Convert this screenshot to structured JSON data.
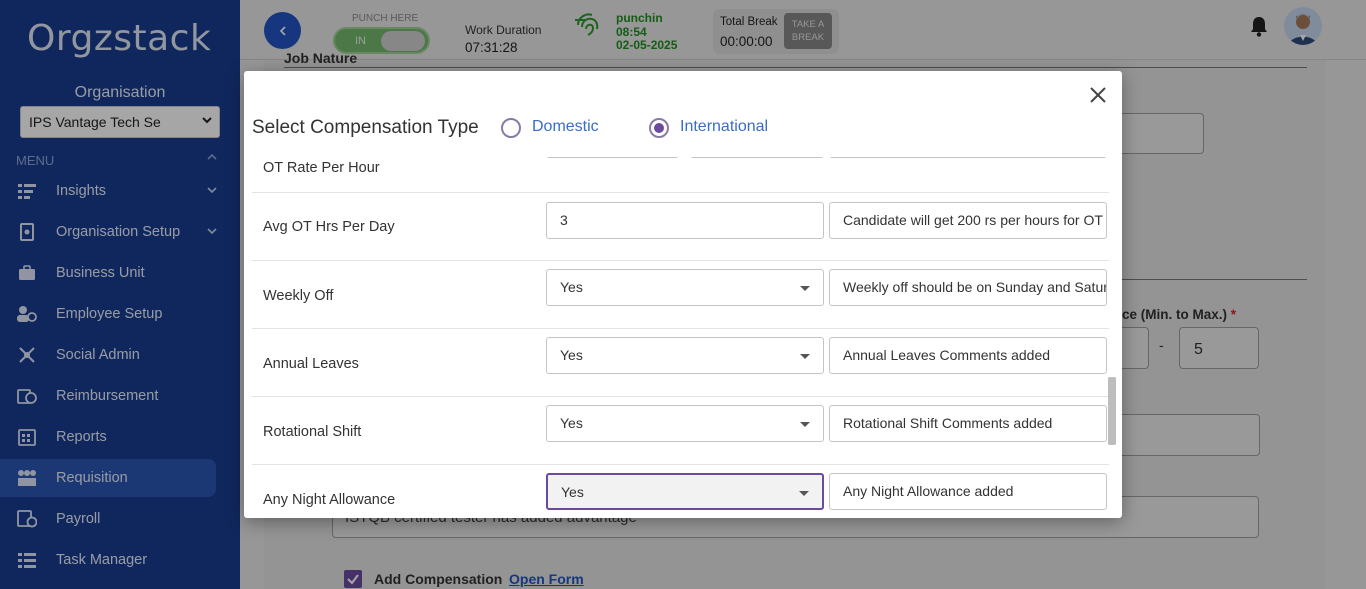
{
  "sidebar": {
    "logo": "Orgzstack",
    "org_label": "Organisation",
    "org_select_value": "IPS Vantage Tech Se",
    "menu_label": "MENU",
    "items": [
      {
        "label": "Insights",
        "icon": "insights-icon"
      },
      {
        "label": "Organisation Setup",
        "icon": "organisation-setup-icon"
      },
      {
        "label": "Business Unit",
        "icon": "briefcase-icon"
      },
      {
        "label": "Employee Setup",
        "icon": "employee-icon"
      },
      {
        "label": "Social Admin",
        "icon": "social-icon"
      },
      {
        "label": "Reimbursement",
        "icon": "reimbursement-icon"
      },
      {
        "label": "Reports",
        "icon": "reports-icon"
      },
      {
        "label": "Requisition",
        "icon": "requisition-icon"
      },
      {
        "label": "Payroll",
        "icon": "payroll-icon"
      },
      {
        "label": "Task Manager",
        "icon": "task-manager-icon"
      }
    ]
  },
  "topbar": {
    "punch_label": "PUNCH HERE",
    "punch_toggle_text": "IN",
    "work_duration_label": "Work Duration",
    "work_duration_value": "07:31:28",
    "punchin_label": "punchin",
    "punchin_time": "08:54",
    "punchin_date": "02-05-2025",
    "total_break_label": "Total Break",
    "total_break_value": "00:00:00",
    "take_break_line1": "TAKE A",
    "take_break_line2": "BREAK"
  },
  "background": {
    "section_heading": "Job Nature",
    "experience_label": "ce (Min. to Max.)",
    "required_mark": "*",
    "range_separator": "-",
    "experience_max": "5",
    "notes_text": "ISTQB certified tester has added advantage",
    "add_compensation_label": "Add Compensation",
    "open_form_link": "Open Form"
  },
  "modal": {
    "title": "Select Compensation Type",
    "option_domestic": "Domestic",
    "option_international": "International",
    "selected_option": "International",
    "rows": [
      {
        "label": "OT Rate Per Hour"
      },
      {
        "label": "Avg OT Hrs Per Day",
        "value": "3",
        "comment": "Candidate will get 200 rs per hours for OT"
      },
      {
        "label": "Weekly Off",
        "value": "Yes",
        "comment": "Weekly off should be on Sunday and Saturday"
      },
      {
        "label": "Annual Leaves",
        "value": "Yes",
        "comment": "Annual Leaves Comments added"
      },
      {
        "label": "Rotational Shift",
        "value": "Yes",
        "comment": "Rotational Shift Comments added"
      },
      {
        "label": "Any Night Allowance",
        "value": "Yes",
        "comment": "Any Night Allowance added"
      }
    ]
  },
  "colors": {
    "sidebar_bg": "#1a3d8f",
    "active_item_bg": "#2c57b3",
    "accent_purple": "#6b4aa0",
    "link_blue": "#3a6cc8",
    "punch_green": "#1f8f1f"
  }
}
